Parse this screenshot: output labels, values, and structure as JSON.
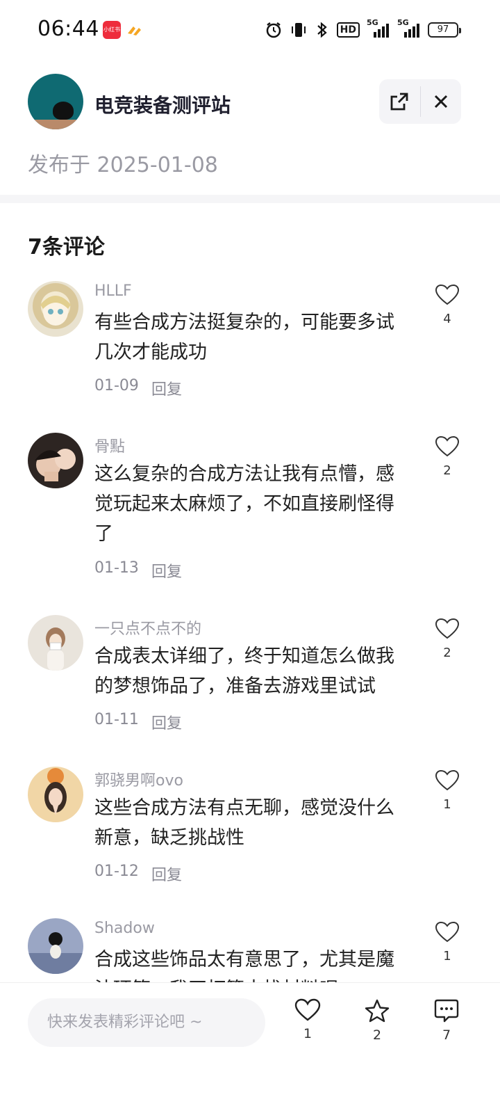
{
  "status_bar": {
    "time": "06:44",
    "badge_app": "小红书",
    "network_1": "5G",
    "network_2": "5G",
    "hd_label": "HD",
    "battery": "97"
  },
  "header": {
    "author": "电竞装备测评站",
    "published": "发布于 2025-01-08"
  },
  "comments_section": {
    "title": "7条评论",
    "comments": [
      {
        "user": "HLLF",
        "text": "有些合成方法挺复杂的，可能要多试几次才能成功",
        "date": "01-09",
        "reply": "回复",
        "likes": "4"
      },
      {
        "user": "骨點",
        "text": "这么复杂的合成方法让我有点懵，感觉玩起来太麻烦了，不如直接刷怪得了",
        "date": "01-13",
        "reply": "回复",
        "likes": "2"
      },
      {
        "user": "一只点不点不的",
        "text": "合成表太详细了，终于知道怎么做我的梦想饰品了，准备去游戏里试试",
        "date": "01-11",
        "reply": "回复",
        "likes": "2"
      },
      {
        "user": "郭骁男啊ovo",
        "text": "这些合成方法有点无聊，感觉没什么新意，缺乏挑战性",
        "date": "01-12",
        "reply": "回复",
        "likes": "1"
      },
      {
        "user": "Shadow",
        "text": "合成这些饰品太有意思了，尤其是魔法环等，我正打算去找材料呢",
        "date": "",
        "reply": "",
        "likes": "1"
      }
    ]
  },
  "bottom_bar": {
    "input_placeholder": "快来发表精彩评论吧 ~",
    "like_count": "1",
    "favorite_count": "2",
    "comment_count": "7"
  }
}
